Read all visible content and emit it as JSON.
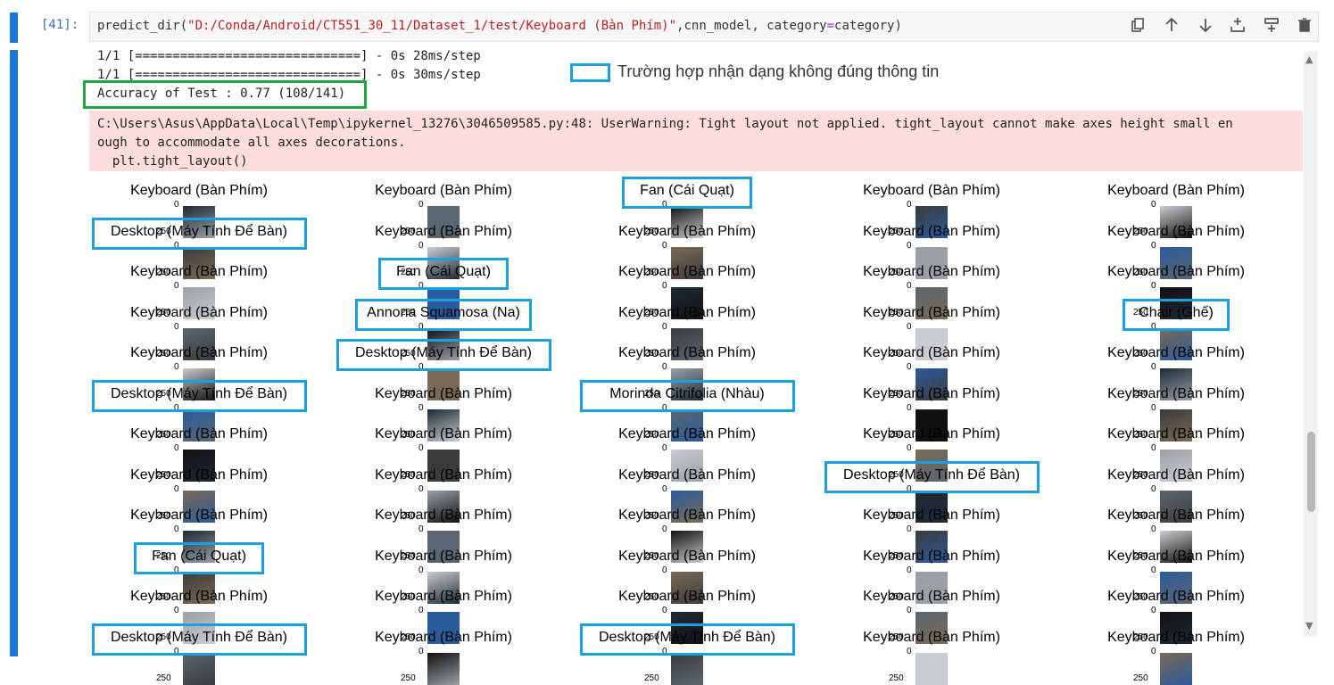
{
  "input_cell": {
    "prompt": "[41]:",
    "code_prefix": "predict_dir(",
    "code_path": "\"D:/Conda/Android/CT551_30_11/Dataset_1/test/Keyboard (Bàn Phím)\"",
    "code_middle": ",cnn_model, category",
    "code_eq": "=",
    "code_suffix": "category)",
    "toolbar": [
      "copy-icon",
      "arrow-up-icon",
      "arrow-down-icon",
      "insert-above-icon",
      "insert-below-icon",
      "trash-icon"
    ]
  },
  "output": {
    "progress_1": "1/1 [==============================] - 0s 28ms/step",
    "progress_2": "1/1 [==============================] - 0s 30ms/step",
    "accuracy": "Accuracy of Test : 0.77 (108/141)",
    "warning": "C:\\Users\\Asus\\AppData\\Local\\Temp\\ipykernel_13276\\3046509585.py:48: UserWarning: Tight layout not applied. tight_layout cannot make axes height small en\nough to accommodate all axes decorations.\n  plt.tight_layout()",
    "legend_text": "Trường hợp nhận dạng không đúng thông tin"
  },
  "grid": {
    "tick_0": "0",
    "tick_250": "250",
    "columns": [
      [
        "Keyboard (Bàn Phím)",
        "Desktop (Máy Tính Để Bàn)",
        "Keyboard (Bàn Phím)",
        "Keyboard (Bàn Phím)",
        "Keyboard (Bàn Phím)",
        "Desktop (Máy Tính Để Bàn)",
        "Keyboard (Bàn Phím)",
        "Keyboard (Bàn Phím)",
        "Keyboard (Bàn Phím)",
        "Fan (Cái Quạt)",
        "Keyboard (Bàn Phím)",
        "Desktop (Máy Tính Để Bàn)"
      ],
      [
        "Keyboard (Bàn Phím)",
        "Keyboard (Bàn Phím)",
        "Fan (Cái Quạt)",
        "Annona Squamosa (Na)",
        "Desktop (Máy Tính Để Bàn)",
        "Keyboard (Bàn Phím)",
        "Keyboard (Bàn Phím)",
        "Keyboard (Bàn Phím)",
        "Keyboard (Bàn Phím)",
        "Keyboard (Bàn Phím)",
        "Keyboard (Bàn Phím)",
        "Keyboard (Bàn Phím)"
      ],
      [
        "Fan (Cái Quạt)",
        "Keyboard (Bàn Phím)",
        "Keyboard (Bàn Phím)",
        "Keyboard (Bàn Phím)",
        "Keyboard (Bàn Phím)",
        "Morinda Citrifolia (Nhàu)",
        "Keyboard (Bàn Phím)",
        "Keyboard (Bàn Phím)",
        "Keyboard (Bàn Phím)",
        "Keyboard (Bàn Phím)",
        "Keyboard (Bàn Phím)",
        "Desktop (Máy Tính Để Bàn)"
      ],
      [
        "Keyboard (Bàn Phím)",
        "Keyboard (Bàn Phím)",
        "Keyboard (Bàn Phím)",
        "Keyboard (Bàn Phím)",
        "Keyboard (Bàn Phím)",
        "Keyboard (Bàn Phím)",
        "Keyboard (Bàn Phím)",
        "Desktop (Máy Tính Để Bàn)",
        "Keyboard (Bàn Phím)",
        "Keyboard (Bàn Phím)",
        "Keyboard (Bàn Phím)",
        "Keyboard (Bàn Phím)"
      ],
      [
        "Keyboard (Bàn Phím)",
        "Keyboard (Bàn Phím)",
        "Keyboard (Bàn Phím)",
        "Chair (Ghế)",
        "Keyboard (Bàn Phím)",
        "Keyboard (Bàn Phím)",
        "Keyboard (Bàn Phím)",
        "Keyboard (Bàn Phím)",
        "Keyboard (Bàn Phím)",
        "Keyboard (Bàn Phím)",
        "Keyboard (Bàn Phím)",
        "Keyboard (Bàn Phím)"
      ]
    ],
    "misclassified": [
      [
        0,
        1
      ],
      [
        0,
        5
      ],
      [
        0,
        9
      ],
      [
        0,
        11
      ],
      [
        1,
        2
      ],
      [
        1,
        3
      ],
      [
        1,
        4
      ],
      [
        2,
        0
      ],
      [
        2,
        5
      ],
      [
        2,
        11
      ],
      [
        3,
        7
      ],
      [
        4,
        3
      ]
    ]
  },
  "colors": {
    "accent_blue": "#1976d2",
    "highlight_blue": "#1aa0e0",
    "accuracy_green": "#22a447",
    "stderr_bg": "#fddddd"
  }
}
